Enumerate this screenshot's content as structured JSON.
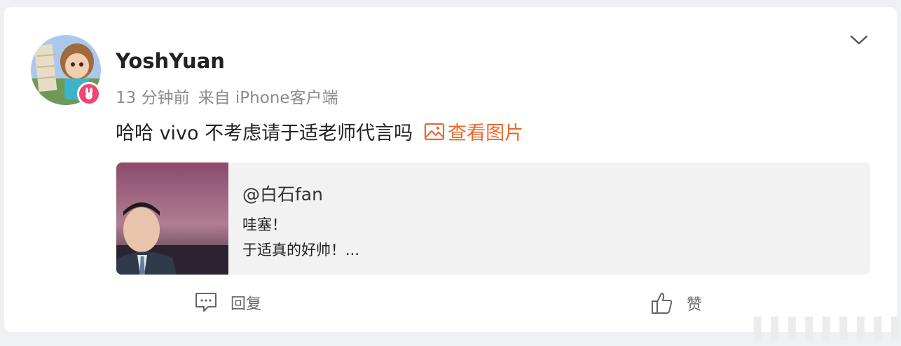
{
  "post": {
    "username": "YoshYuan",
    "time_ago": "13 分钟前",
    "source": "来自 iPhone客户端",
    "text": "哈哈 vivo 不考虑请于适老师代言吗",
    "view_image_label": "查看图片"
  },
  "quote": {
    "author": "@白石fan",
    "line1": "哇塞！",
    "line2": "于适真的好帅！..."
  },
  "actions": {
    "reply_label": "回复",
    "like_label": "赞"
  },
  "icons": {
    "badge": "vip-rabbit-badge-icon",
    "more": "chevron-down-icon",
    "image": "image-icon",
    "reply": "comment-icon",
    "like": "thumbs-up-icon"
  },
  "colors": {
    "accent": "#e8692e",
    "badge": "#f0456f"
  }
}
